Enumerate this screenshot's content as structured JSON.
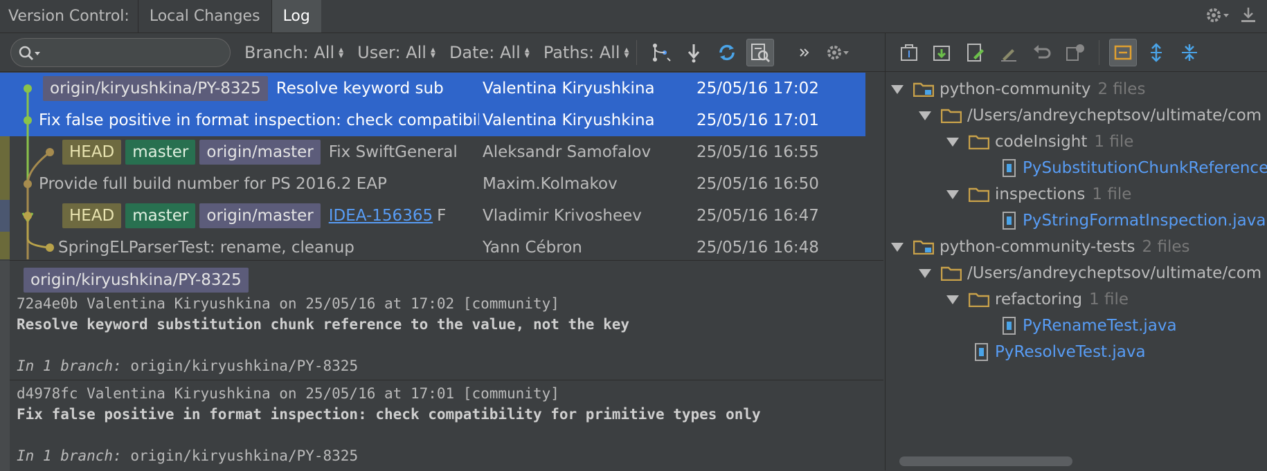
{
  "tabs": {
    "title": "Version Control:",
    "items": [
      "Local Changes",
      "Log"
    ],
    "active": 1
  },
  "toolbar": {
    "search_placeholder": "",
    "filters": [
      "Branch: All",
      "User: All",
      "Date: All",
      "Paths: All"
    ]
  },
  "commits": [
    {
      "labels": [
        {
          "text": "origin/kiryushkina/PY-8325",
          "kind": "origin"
        }
      ],
      "message": "Resolve keyword sub",
      "author": "Valentina Kiryushkina",
      "date": "25/05/16 17:02",
      "selected": true
    },
    {
      "labels": [],
      "message": "Fix false positive in format inspection: check compatibil",
      "author": "Valentina Kiryushkina",
      "date": "25/05/16 17:01",
      "selected": true
    },
    {
      "labels": [
        {
          "text": "HEAD",
          "kind": "head"
        },
        {
          "text": "master",
          "kind": "master"
        },
        {
          "text": "origin/master",
          "kind": "origin"
        }
      ],
      "message": "Fix SwiftGeneral",
      "author": "Aleksandr Samofalov",
      "date": "25/05/16 16:55",
      "selected": false
    },
    {
      "labels": [],
      "message": "Provide full build number for PS 2016.2 EAP",
      "author": "Maxim.Kolmakov",
      "date": "25/05/16 16:50",
      "selected": false
    },
    {
      "labels": [
        {
          "text": "HEAD",
          "kind": "head"
        },
        {
          "text": "master",
          "kind": "master"
        },
        {
          "text": "origin/master",
          "kind": "origin"
        }
      ],
      "link": "IDEA-156365",
      "message": "F",
      "author": "Vladimir Krivosheev",
      "date": "25/05/16 16:47",
      "selected": false
    },
    {
      "labels": [],
      "message": "SpringELParserTest: rename, cleanup",
      "author": "Yann Cébron",
      "date": "25/05/16 16:48",
      "selected": false
    }
  ],
  "details": {
    "label": "origin/kiryushkina/PY-8325",
    "entries": [
      {
        "header": "72a4e0b Valentina Kiryushkina on 25/05/16 at 17:02 [community]",
        "subject": "Resolve keyword substitution chunk reference to the value, not the key",
        "branch_prefix": "In 1 branch:",
        "branch": "origin/kiryushkina/PY-8325"
      },
      {
        "header": "d4978fc Valentina Kiryushkina on 25/05/16 at 17:01 [community]",
        "subject": "Fix false positive in format inspection: check compatibility for primitive types only",
        "branch_prefix": "In 1 branch:",
        "branch": "origin/kiryushkina/PY-8325"
      }
    ]
  },
  "tree": [
    {
      "name": "python-community",
      "count": "2 files"
    },
    {
      "name": "/Users/andreycheptsov/ultimate/com"
    },
    {
      "name": "codeInsight",
      "count": "1 file"
    },
    {
      "name": "PySubstitutionChunkReference."
    },
    {
      "name": "inspections",
      "count": "1 file"
    },
    {
      "name": "PyStringFormatInspection.java"
    },
    {
      "name": "python-community-tests",
      "count": "2 files"
    },
    {
      "name": "/Users/andreycheptsov/ultimate/com"
    },
    {
      "name": "refactoring",
      "count": "1 file"
    },
    {
      "name": "PyRenameTest.java"
    },
    {
      "name": "PyResolveTest.java"
    }
  ],
  "colors": {
    "selection": "#2f65ca",
    "graph_yellow": "#a5a040",
    "graph_green": "#8bc34a",
    "graph_tan": "#a68b4e",
    "file_blue": "#589df6",
    "folder": "#c9a24a"
  }
}
